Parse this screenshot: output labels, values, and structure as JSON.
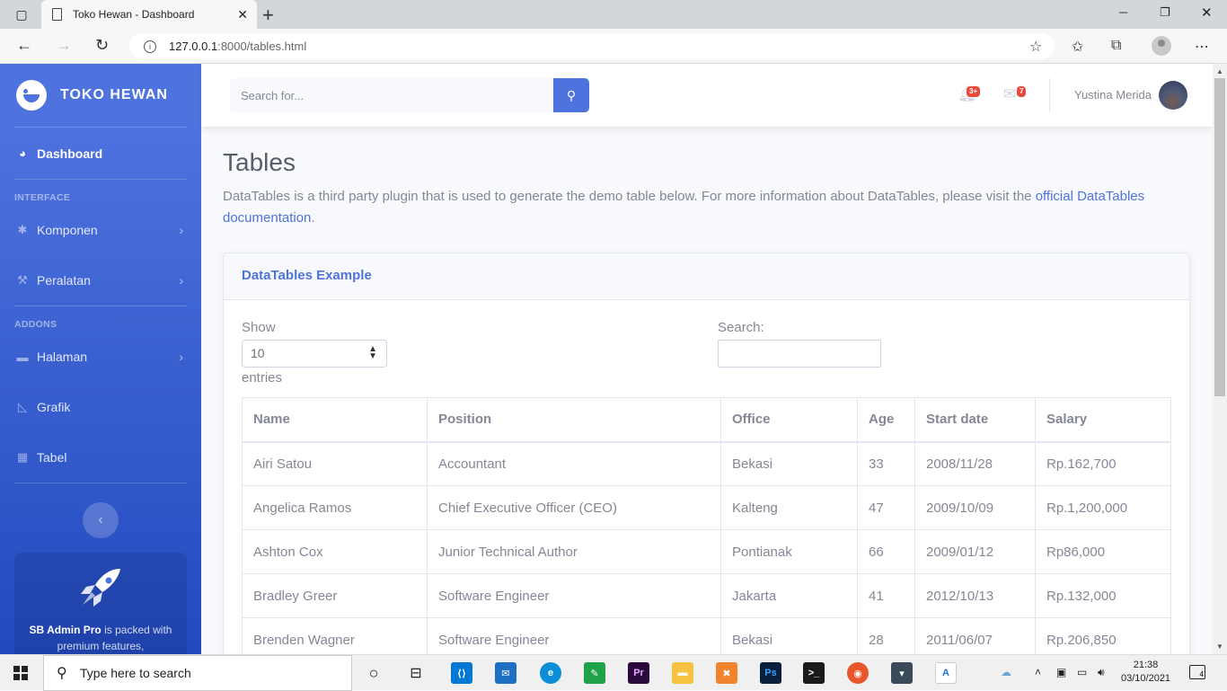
{
  "browser": {
    "tab_title": "Toko Hewan - Dashboard",
    "new_tab_symbol": "+",
    "url_host": "127.0.0.1",
    "url_path": ":8000/tables.html"
  },
  "sidebar": {
    "brand": "TOKO HEWAN",
    "dashboard": "Dashboard",
    "heading_interface": "INTERFACE",
    "items_interface": [
      {
        "label": "Komponen"
      },
      {
        "label": "Peralatan"
      }
    ],
    "heading_addons": "ADDONS",
    "items_addons": [
      {
        "label": "Halaman"
      },
      {
        "label": "Grafik"
      },
      {
        "label": "Tabel"
      }
    ],
    "promo_bold": "SB Admin Pro",
    "promo_text": " is packed with premium features,"
  },
  "topbar": {
    "search_placeholder": "Search for...",
    "alerts_badge": "3+",
    "messages_badge": "7",
    "user_name": "Yustina Merida"
  },
  "page": {
    "title": "Tables",
    "description": "DataTables is a third party plugin that is used to generate the demo table below. For more information about DataTables, please visit the ",
    "link_text": "official DataTables documentation",
    "description_end": "."
  },
  "card": {
    "title": "DataTables Example",
    "show_label": "Show",
    "entries_value": "10",
    "entries_label": "entries",
    "search_label": "Search:",
    "columns": [
      "Name",
      "Position",
      "Office",
      "Age",
      "Start date",
      "Salary"
    ],
    "rows": [
      [
        "Airi Satou",
        "Accountant",
        "Bekasi",
        "33",
        "2008/11/28",
        "Rp.162,700"
      ],
      [
        "Angelica Ramos",
        "Chief Executive Officer (CEO)",
        "Kalteng",
        "47",
        "2009/10/09",
        "Rp.1,200,000"
      ],
      [
        "Ashton Cox",
        "Junior Technical Author",
        "Pontianak",
        "66",
        "2009/01/12",
        "Rp86,000"
      ],
      [
        "Bradley Greer",
        "Software Engineer",
        "Jakarta",
        "41",
        "2012/10/13",
        "Rp.132,000"
      ],
      [
        "Brenden Wagner",
        "Software Engineer",
        "Bekasi",
        "28",
        "2011/06/07",
        "Rp.206,850"
      ]
    ]
  },
  "taskbar": {
    "search_text": "Type here to search",
    "time": "21:38",
    "date": "03/10/2021",
    "notification_count": "4"
  }
}
